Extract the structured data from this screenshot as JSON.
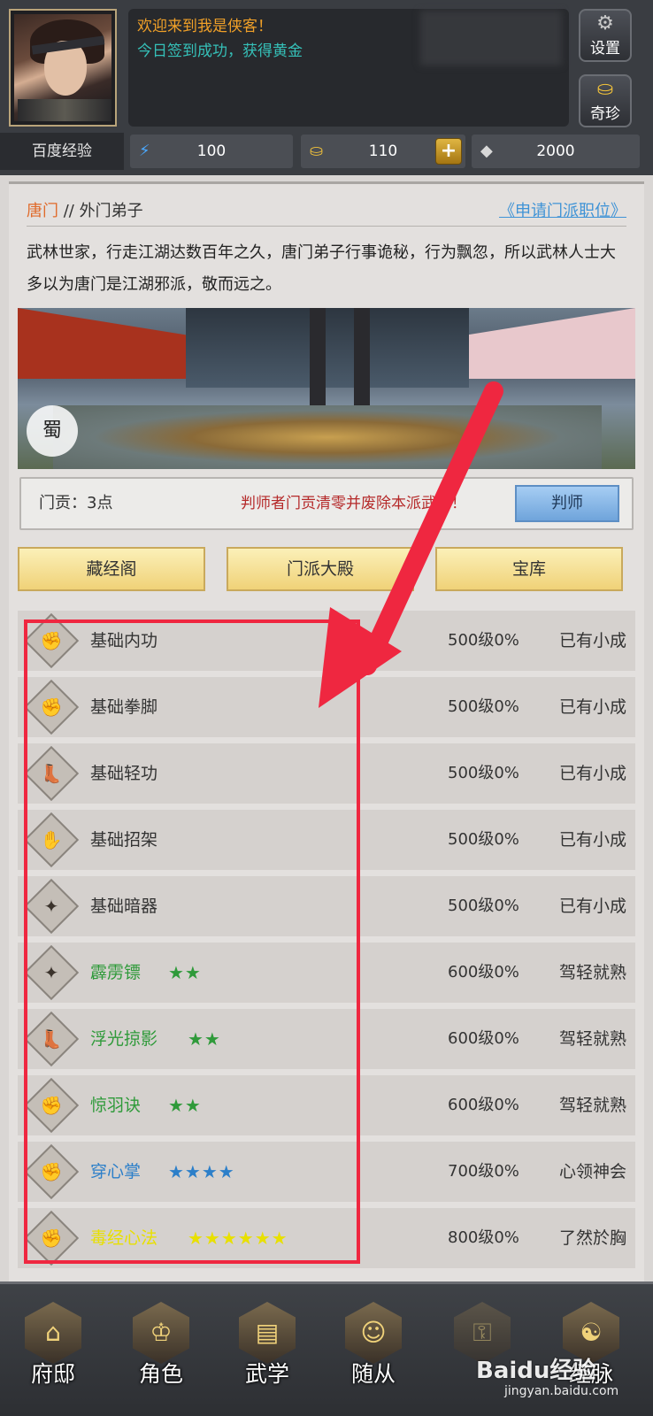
{
  "header": {
    "message_line1": "欢迎来到我是侠客！",
    "message_line2": "今日签到成功，获得黄金",
    "settings_label": "设置",
    "treasure_label": "奇珍",
    "baidu_xp_label": "百度经验",
    "energy_value": "100",
    "gold_value": "110",
    "silver_value": "2000",
    "plus_symbol": "+"
  },
  "sect": {
    "name": "唐门",
    "separator": " // ",
    "rank": "外门弟子",
    "apply_link": "《申请门派职位》",
    "description": "武林世家，行走江湖达数百年之久，唐门弟子行事诡秘，行为飘忽，所以武林人士大多以为唐门是江湖邪派，敬而远之。",
    "banner_emblem": "蜀",
    "contribution_label": "门贡：3点",
    "betray_warning": "判师者门贡清零并废除本派武学！",
    "betray_button": "判师"
  },
  "buttons": {
    "library": "藏经阁",
    "hall": "门派大殿",
    "vault": "宝库"
  },
  "skills": [
    {
      "icon": "body-icon",
      "glyph": "✊",
      "name": "基础内功",
      "stars": "",
      "level": "500级0%",
      "rank": "已有小成",
      "color": ""
    },
    {
      "icon": "fist-icon",
      "glyph": "✊",
      "name": "基础拳脚",
      "stars": "",
      "level": "500级0%",
      "rank": "已有小成",
      "color": ""
    },
    {
      "icon": "boot-icon",
      "glyph": "👢",
      "name": "基础轻功",
      "stars": "",
      "level": "500级0%",
      "rank": "已有小成",
      "color": ""
    },
    {
      "icon": "parry-icon",
      "glyph": "✋",
      "name": "基础招架",
      "stars": "",
      "level": "500级0%",
      "rank": "已有小成",
      "color": ""
    },
    {
      "icon": "dart-icon",
      "glyph": "✦",
      "name": "基础暗器",
      "stars": "",
      "level": "500级0%",
      "rank": "已有小成",
      "color": ""
    },
    {
      "icon": "dart-icon",
      "glyph": "✦",
      "name": "霹雳镖",
      "stars": "★★",
      "level": "600级0%",
      "rank": "驾轻就熟",
      "color": "green"
    },
    {
      "icon": "boot-icon",
      "glyph": "👢",
      "name": "浮光掠影",
      "stars": "★★",
      "level": "600级0%",
      "rank": "驾轻就熟",
      "color": "green"
    },
    {
      "icon": "body-icon",
      "glyph": "✊",
      "name": "惊羽诀",
      "stars": "★★",
      "level": "600级0%",
      "rank": "驾轻就熟",
      "color": "green"
    },
    {
      "icon": "fist-icon",
      "glyph": "✊",
      "name": "穿心掌",
      "stars": "★★★★",
      "level": "700级0%",
      "rank": "心领神会",
      "color": "blue"
    },
    {
      "icon": "body-icon",
      "glyph": "✊",
      "name": "毒经心法",
      "stars": "★★★★★★",
      "level": "800级0%",
      "rank": "了然於胸",
      "color": "yellow"
    }
  ],
  "nav": {
    "mansion": "府邸",
    "role": "角色",
    "martial": "武学",
    "follower": "随从",
    "locked": "",
    "sixth": "经脉"
  },
  "watermark": {
    "brand": "Baidu经验",
    "url": "jingyan.baidu.com"
  },
  "colors": {
    "green": "#2f9a3a",
    "blue": "#2c7fc9",
    "yellow": "#e8e000",
    "highlight": "#ef2740"
  }
}
